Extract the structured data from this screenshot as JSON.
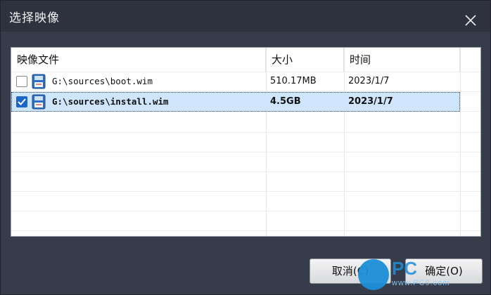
{
  "window": {
    "title": "选择映像"
  },
  "columns": {
    "file": "映像文件",
    "size": "大小",
    "time": "时间"
  },
  "rows": [
    {
      "checked": false,
      "path": "G:\\sources\\boot.wim",
      "size": "510.17MB",
      "time": "2023/1/7"
    },
    {
      "checked": true,
      "path": "G:\\sources\\install.wim",
      "size": "4.5GB",
      "time": "2023/1/7"
    }
  ],
  "buttons": {
    "cancel": "取消(C)",
    "ok": "确定(O)"
  },
  "watermark": {
    "brand": "PC",
    "url": "www.PC9.com"
  },
  "colors": {
    "accent": "#1a66c9",
    "selection": "#cfe5fb",
    "dialog_bg": "#373c4a",
    "titlebar": "#2e323f"
  }
}
